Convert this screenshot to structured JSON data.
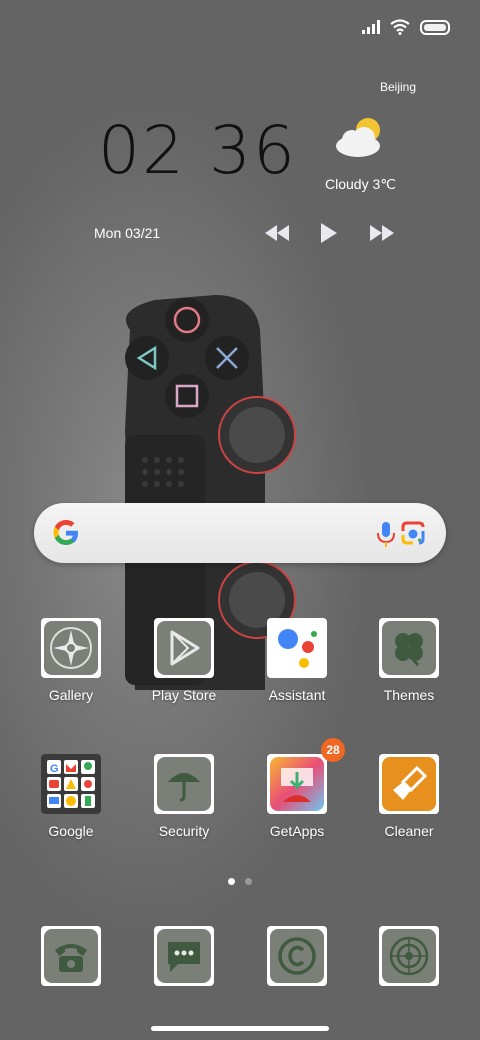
{
  "status": {
    "icons": [
      "signal-icon",
      "wifi-icon",
      "battery-icon"
    ]
  },
  "widget": {
    "city": "Beijing",
    "time": "02 36",
    "weather": "Cloudy  3℃",
    "date": "Mon 03/21"
  },
  "media_controls": [
    "rewind-icon",
    "play-icon",
    "fast-forward-icon"
  ],
  "search": {
    "icons": [
      "google-g-icon",
      "microphone-icon",
      "lens-camera-icon"
    ]
  },
  "apps": [
    {
      "label": "Gallery",
      "icon": "gallery-icon"
    },
    {
      "label": "Play Store",
      "icon": "play-store-icon"
    },
    {
      "label": "Assistant",
      "icon": "assistant-icon"
    },
    {
      "label": "Themes",
      "icon": "clover-icon"
    },
    {
      "label": "Google",
      "icon": "google-folder-icon"
    },
    {
      "label": "Security",
      "icon": "umbrella-icon"
    },
    {
      "label": "GetApps",
      "icon": "getapps-icon",
      "badge": "28"
    },
    {
      "label": "Cleaner",
      "icon": "broom-icon"
    }
  ],
  "dock": [
    {
      "icon": "phone-icon"
    },
    {
      "icon": "messages-icon"
    },
    {
      "icon": "copyright-icon"
    },
    {
      "icon": "target-icon"
    }
  ],
  "pager": {
    "pages": 2,
    "current": 1
  },
  "colors": {
    "wallpaper": "#646464",
    "icon_green": "#7a8077",
    "badge": "#ef6723"
  }
}
